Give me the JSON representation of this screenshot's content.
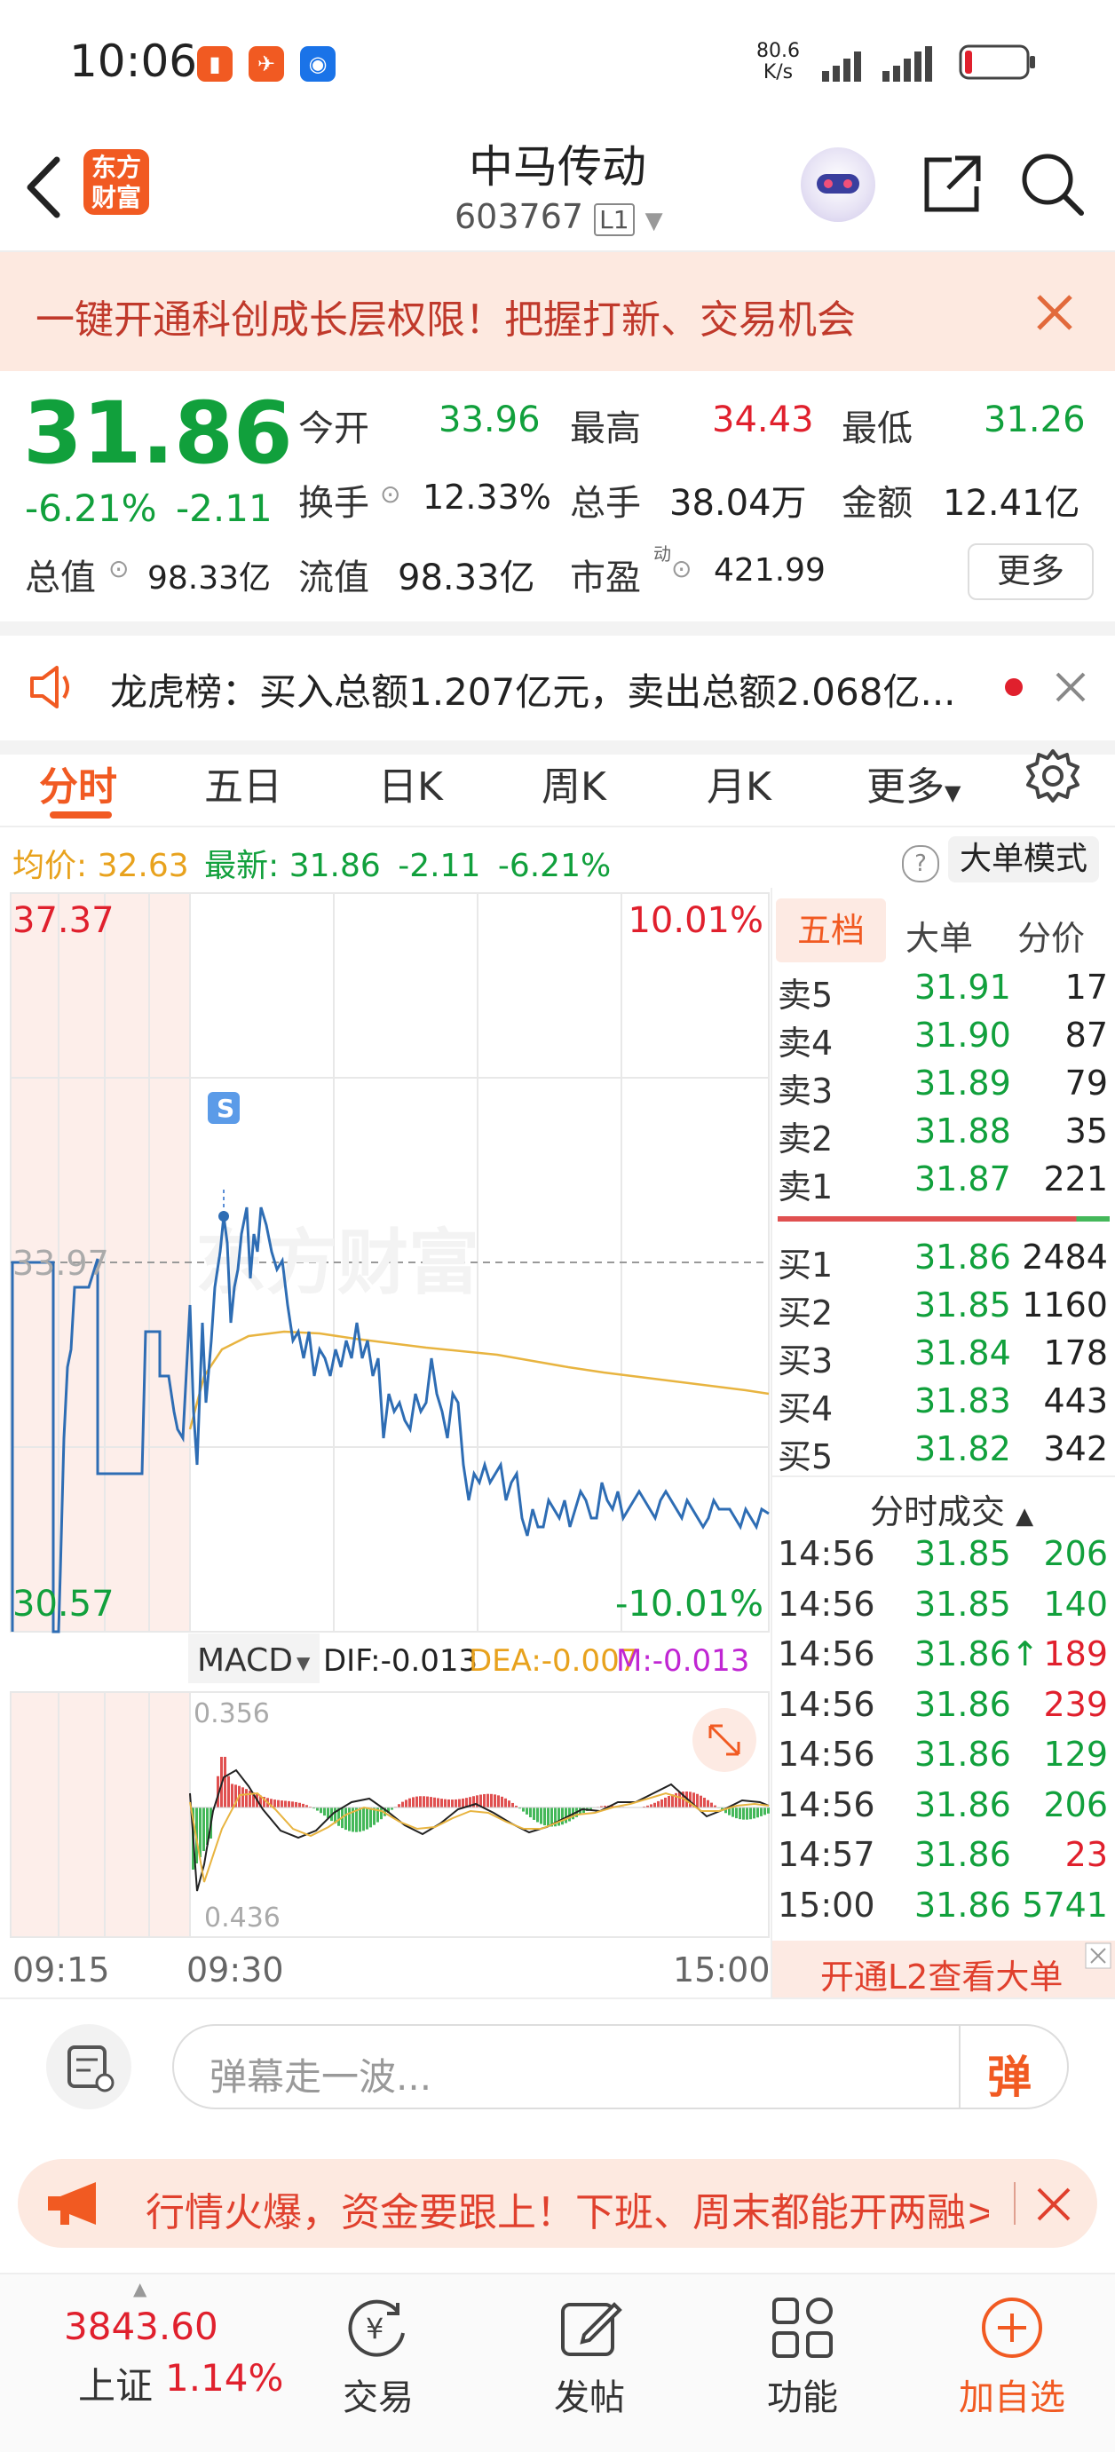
{
  "status": {
    "time": "10:06",
    "speed_top": "80.6",
    "speed_bottom": "K/s"
  },
  "header": {
    "logo": "东方\n财富",
    "logo_line1": "东方",
    "logo_line2": "财富",
    "title": "中马传动",
    "code": "603767",
    "level": "L1"
  },
  "banner": {
    "text": "一键开通科创成长层权限！把握打新、交易机会"
  },
  "quote": {
    "price": "31.86",
    "change_pct": "-6.21%",
    "change": "-2.11",
    "open_label": "今开",
    "open": "33.96",
    "high_label": "最高",
    "high": "34.43",
    "low_label": "最低",
    "low": "31.26",
    "turnover_label": "换手",
    "turnover": "12.33%",
    "volume_label": "总手",
    "volume": "38.04万",
    "amount_label": "金额",
    "amount": "12.41亿",
    "mcap_label": "总值",
    "mcap": "98.33亿",
    "float_label": "流值",
    "float": "98.33亿",
    "pe_label": "市盈",
    "pe_sup": "动",
    "pe": "421.99",
    "more": "更多"
  },
  "notice": {
    "text": "龙虎榜：买入总额1.207亿元，卖出总额2.068亿..."
  },
  "tabs": [
    "分时",
    "五日",
    "日K",
    "周K",
    "月K",
    "更多"
  ],
  "info_bar": {
    "avg_label": "均价:",
    "avg": "32.63",
    "latest_label": "最新:",
    "latest": "31.86",
    "change": "-2.11",
    "pct": "-6.21%",
    "mode": "大单模式"
  },
  "chart": {
    "y_max": "37.37",
    "y_min": "30.57",
    "pct_max": "10.01%",
    "pct_min": "-10.01%",
    "ref": "33.97",
    "marker": "S",
    "watermark": "东方财富",
    "macd_label": "MACD",
    "dif": "DIF:-0.013",
    "dea": "DEA:-0.007",
    "m": "M:-0.013",
    "macd_top": "0.356",
    "macd_bottom": "0.436",
    "x_start": "09:15",
    "x_open": "09:30",
    "x_end": "15:00"
  },
  "book": {
    "tabs": [
      "五档",
      "大单",
      "分价"
    ],
    "asks": [
      {
        "l": "卖5",
        "p": "31.91",
        "v": "17"
      },
      {
        "l": "卖4",
        "p": "31.90",
        "v": "87"
      },
      {
        "l": "卖3",
        "p": "31.89",
        "v": "79"
      },
      {
        "l": "卖2",
        "p": "31.88",
        "v": "35"
      },
      {
        "l": "卖1",
        "p": "31.87",
        "v": "221"
      }
    ],
    "bids": [
      {
        "l": "买1",
        "p": "31.86",
        "v": "2484"
      },
      {
        "l": "买2",
        "p": "31.85",
        "v": "1160"
      },
      {
        "l": "买3",
        "p": "31.84",
        "v": "178"
      },
      {
        "l": "买4",
        "p": "31.83",
        "v": "443"
      },
      {
        "l": "买5",
        "p": "31.82",
        "v": "342"
      }
    ],
    "ticks_title": "分时成交",
    "ticks": [
      {
        "t": "14:56",
        "p": "31.85",
        "v": "206",
        "c": "green"
      },
      {
        "t": "14:56",
        "p": "31.85",
        "v": "140",
        "c": "green"
      },
      {
        "t": "14:56",
        "p": "31.86↑",
        "v": "189",
        "c": "red"
      },
      {
        "t": "14:56",
        "p": "31.86",
        "v": "239",
        "c": "red"
      },
      {
        "t": "14:56",
        "p": "31.86",
        "v": "129",
        "c": "green"
      },
      {
        "t": "14:56",
        "p": "31.86",
        "v": "206",
        "c": "green"
      },
      {
        "t": "14:57",
        "p": "31.86",
        "v": "23",
        "c": "red"
      },
      {
        "t": "15:00",
        "p": "31.86",
        "v": "5741",
        "c": "green"
      }
    ],
    "l2": "开通L2查看大单"
  },
  "danmaku": {
    "placeholder": "弹幕走一波...",
    "btn": "弹"
  },
  "ad": {
    "text": "行情火爆，资金要跟上！下班、周末都能开两融>"
  },
  "nav": {
    "index_value": "3843.60",
    "index_name": "上证",
    "index_pct": "1.14%",
    "items": [
      "交易",
      "发帖",
      "功能",
      "加自选"
    ]
  },
  "colors": {
    "up": "#e0202d",
    "down": "#11a03c",
    "accent": "#f15a22",
    "avg": "#e8a21d",
    "line": "#2e6db4"
  }
}
